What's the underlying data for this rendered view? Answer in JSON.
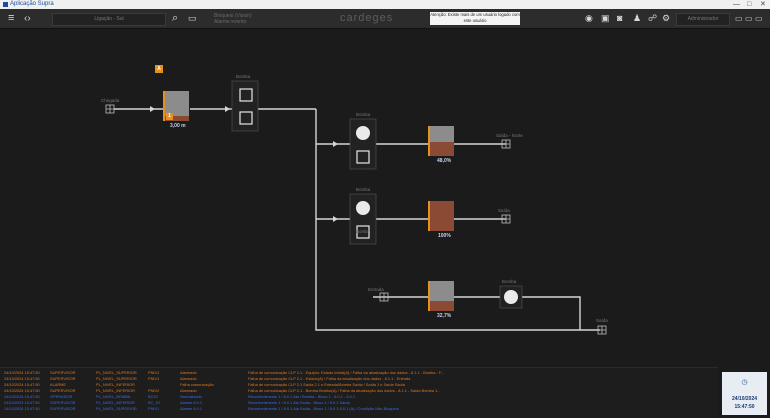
{
  "window": {
    "title": "Aplicação Supra",
    "controls": [
      "—",
      "□",
      "✕"
    ]
  },
  "toolbar": {
    "menu_icon": "hamburger-menu-icon",
    "code_icon": "code-brackets-icon",
    "search_field": "Ligação - Sul",
    "search_icon": "search-icon",
    "monitor_icon": "monitor-icon",
    "info_line1": "Bloqueio (Vision)",
    "info_line2": "Alarme evento",
    "brand": "cardeges",
    "alert_text": "Atenção: Existe mais de um usuário logado com este usuário",
    "right_icons": [
      "eye-icon",
      "panel-icon",
      "camera-icon",
      "user-icon",
      "group-icon",
      "settings-icon"
    ],
    "user_field": "Administrador",
    "extra_icons": [
      "window-icon",
      "window-icon",
      "window-icon"
    ]
  },
  "diagram": {
    "badges": [
      {
        "id": "b1",
        "text": "A"
      },
      {
        "id": "b2",
        "text": "1"
      }
    ],
    "labels": [
      {
        "id": "l1",
        "text": "Chegada"
      },
      {
        "id": "l2",
        "text": "Bomba"
      },
      {
        "id": "l3",
        "text": "Bomba"
      },
      {
        "id": "l4",
        "text": "Saída - Norte"
      },
      {
        "id": "l5",
        "text": "Bomba"
      },
      {
        "id": "l6",
        "text": "Saída"
      },
      {
        "id": "l7",
        "text": "Bomba"
      },
      {
        "id": "l8",
        "text": "Entrada"
      },
      {
        "id": "l9",
        "text": "Bomba"
      },
      {
        "id": "l10",
        "text": "Saída"
      }
    ],
    "tanks": [
      {
        "id": "t1",
        "pct": "3,00 m",
        "level": 0.15
      },
      {
        "id": "t2",
        "pct": "48,0%",
        "level": 0.48
      },
      {
        "id": "t3",
        "pct": "100%",
        "level": 1.0
      },
      {
        "id": "t4",
        "pct": "32,7%",
        "level": 0.33
      }
    ]
  },
  "log": {
    "rows": [
      {
        "time": "24/10/2024 15:47:50",
        "user": "SUPERVISOR",
        "point": "PL_NIVEL_SUPERIOR",
        "code": "PNIV1",
        "type": "Alarmado",
        "msg": "Falha de comunicação CLP 2.1 - Equipto: Estado Inicial(A) / Falha da atualização dos dados - 8.1.1 - Bomba - F...",
        "color": "#e07820"
      },
      {
        "time": "24/10/2024 15:47:50",
        "user": "SUPERVISOR",
        "point": "PL_NIVEL_SUPERIOR",
        "code": "PNIV1",
        "type": "Alarmado",
        "msg": "Falha de comunicação CLP 2.1 - Estado(A) / Falha da atualização dos dados - 8.1.1 - Entrada",
        "color": "#e07820"
      },
      {
        "time": "24/10/2024 15:47:50",
        "user": "ALARME",
        "point": "PL_NIVEL_INFERIOR",
        "code": "",
        "type": "Falha comunicação",
        "msg": "Falha de comunicação CLP 2.1 Saída 2.1 e Entrada/Bomba Saída / Saída 1 e Saída Saída",
        "color": "#e07820"
      },
      {
        "time": "24/10/2024 15:47:50",
        "user": "SUPERVISOR",
        "point": "PL_NIVEL_INFERIOR",
        "code": "PNIV2",
        "type": "Alarmado",
        "msg": "Falha de comunicação CLP 2.1 - Bomba Bomba(A) / Falha da atualização dos dados - 8.1.1 - Saída Bomba 1...",
        "color": "#e07820"
      },
      {
        "time": "24/10/2024 15:47:50",
        "user": "OPERADOR",
        "point": "PL_NIVEL_BOMBA",
        "code": "BCS1",
        "type": "Normalizado",
        "msg": "Reconhecimento 1 / 8.0.1 Ala / Bomba - Bloco 1 - 8.0.1 - 8.0.1",
        "color": "#3a6ee8"
      },
      {
        "time": "24/10/2024 15:47:50",
        "user": "SUPERVISOR",
        "point": "PL_NIVEL_INFERIOR",
        "code": "BC_S1",
        "type": "Alarme 8.0.1",
        "msg": "Reconhecimento 1 / 8.0.1 Ala Saída - Bloco 1 / 8.0.1 Saída",
        "color": "#3a6ee8"
      },
      {
        "time": "24/10/2024 15:47:50",
        "user": "SUPERVISOR",
        "point": "PL_NIVEL_SUPERIOR",
        "code": "PNIV1",
        "type": "Alarme 8.0.1",
        "msg": "Reconhecimento 1 / 8.0.1 Ala Saída - Bloco 1 / 8.0.1 8.0.1 (A) / Condição Não-Bloqueio",
        "color": "#3a6ee8"
      }
    ]
  },
  "clock": {
    "date": "24/10/2024",
    "time": "15:47:50"
  },
  "colors": {
    "accent": "#e8901a",
    "tank_fill": "#8a4a33",
    "tank_body": "#8c8c8c",
    "pipe": "#d6d6d6"
  }
}
